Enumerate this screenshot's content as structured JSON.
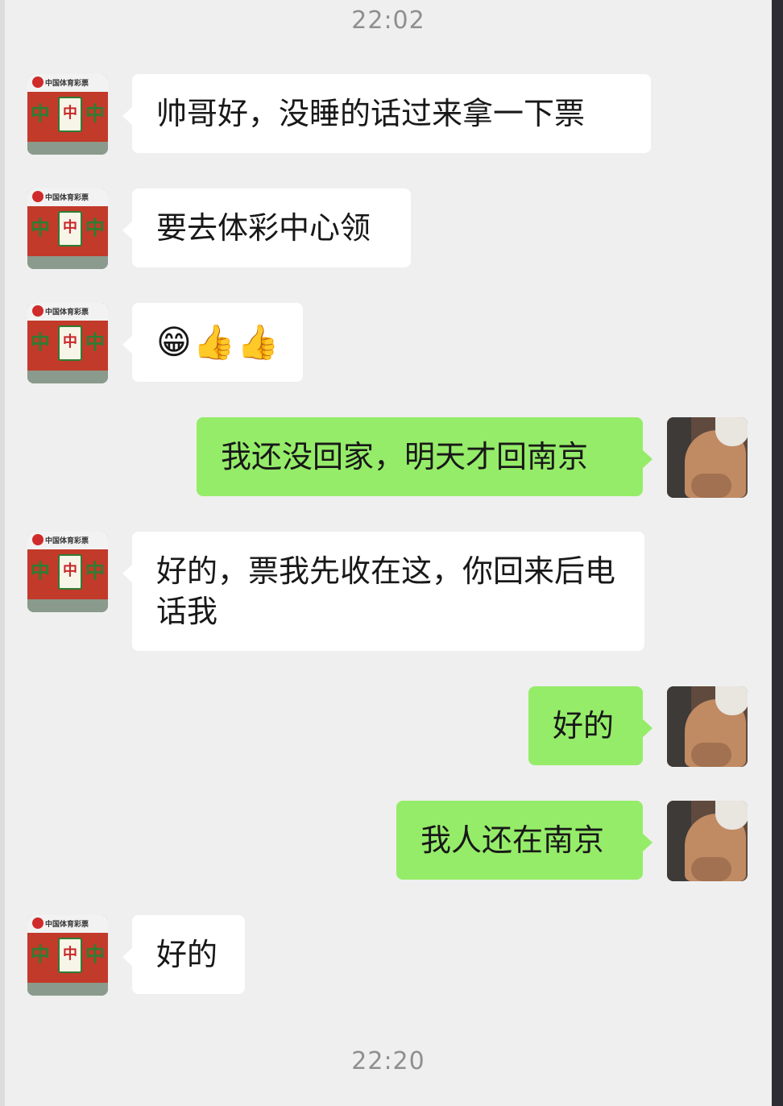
{
  "timestamps": [
    "22:02",
    "22:20"
  ],
  "messages": [
    {
      "side": "in",
      "text": "帅哥好，没睡的话过来拿一下票"
    },
    {
      "side": "in",
      "text": "要去体彩中心领"
    },
    {
      "side": "in",
      "text": "😁👍👍"
    },
    {
      "side": "out",
      "text": "我还没回家，明天才回南京"
    },
    {
      "side": "in",
      "text": "好的，票我先收在这，你回来后电话我"
    },
    {
      "side": "out",
      "text": "好的"
    },
    {
      "side": "out",
      "text": "我人还在南京"
    },
    {
      "side": "in",
      "text": "好的"
    }
  ],
  "contact_avatar": {
    "caption": "中国体育彩票",
    "tile_char": "中"
  },
  "colors": {
    "incoming_bubble": "#ffffff",
    "outgoing_bubble": "#95ec69",
    "background": "#efefef"
  }
}
